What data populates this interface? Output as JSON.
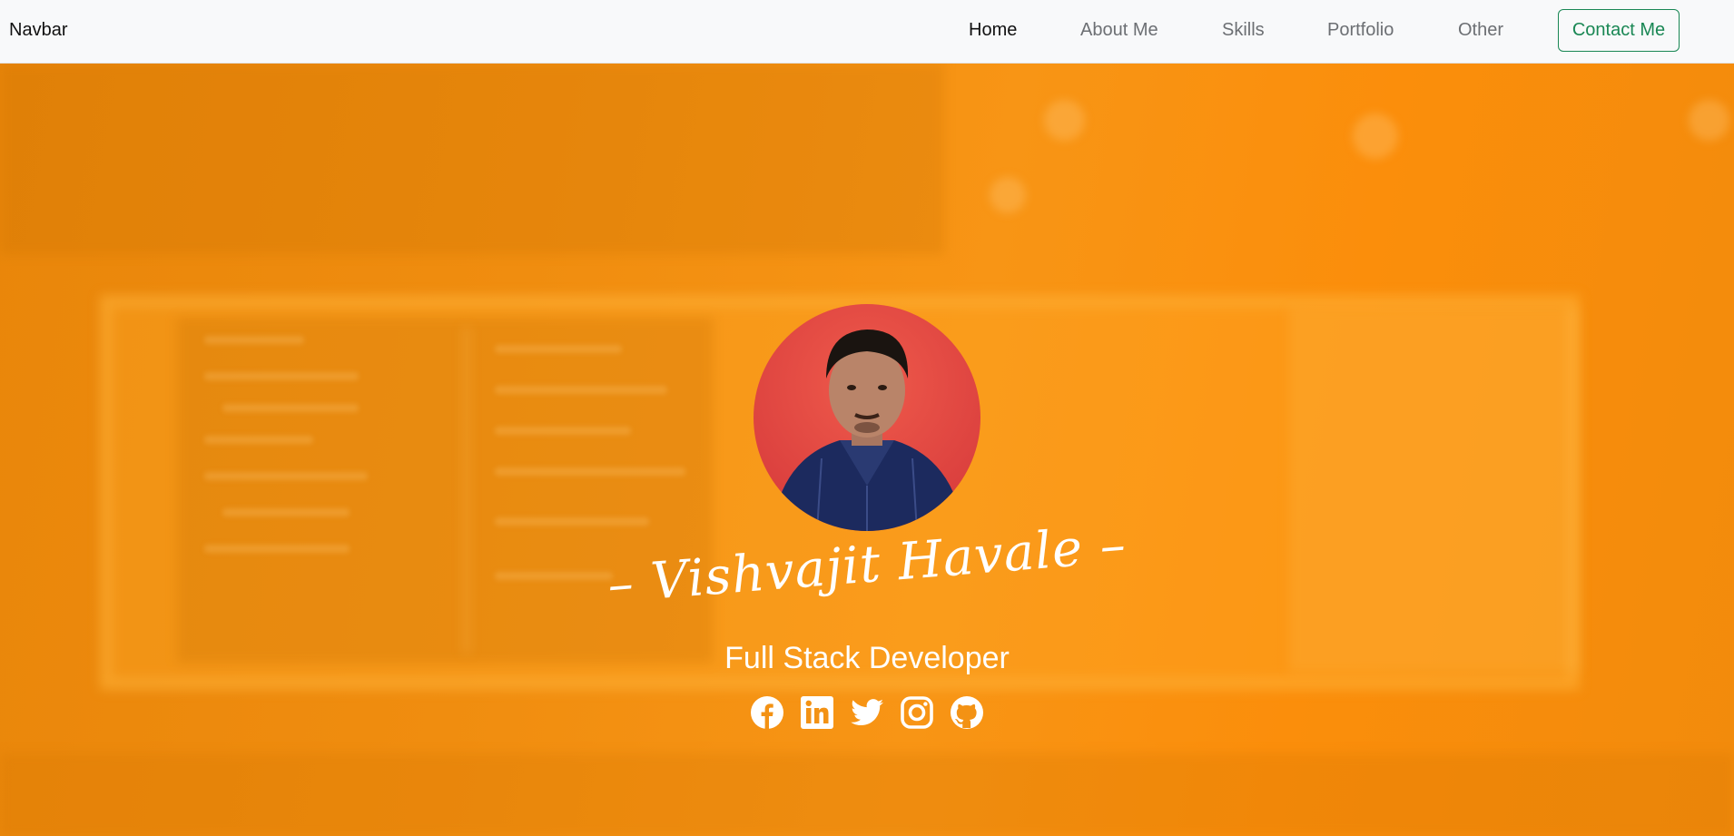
{
  "navbar": {
    "brand": "Navbar",
    "links": [
      {
        "label": "Home",
        "active": true
      },
      {
        "label": "About Me",
        "active": false
      },
      {
        "label": "Skills",
        "active": false
      },
      {
        "label": "Portfolio",
        "active": false
      },
      {
        "label": "Other",
        "active": false
      }
    ],
    "contact_button": "Contact Me"
  },
  "hero": {
    "name": "– Vishvajit Havale –",
    "role": "Full Stack Developer",
    "socials": [
      {
        "icon": "facebook-icon"
      },
      {
        "icon": "linkedin-icon"
      },
      {
        "icon": "twitter-icon"
      },
      {
        "icon": "instagram-icon"
      },
      {
        "icon": "github-icon"
      }
    ]
  },
  "colors": {
    "hero_orange": "#f39214",
    "contact_green": "#198754",
    "navbar_bg": "#f8f9fa"
  }
}
